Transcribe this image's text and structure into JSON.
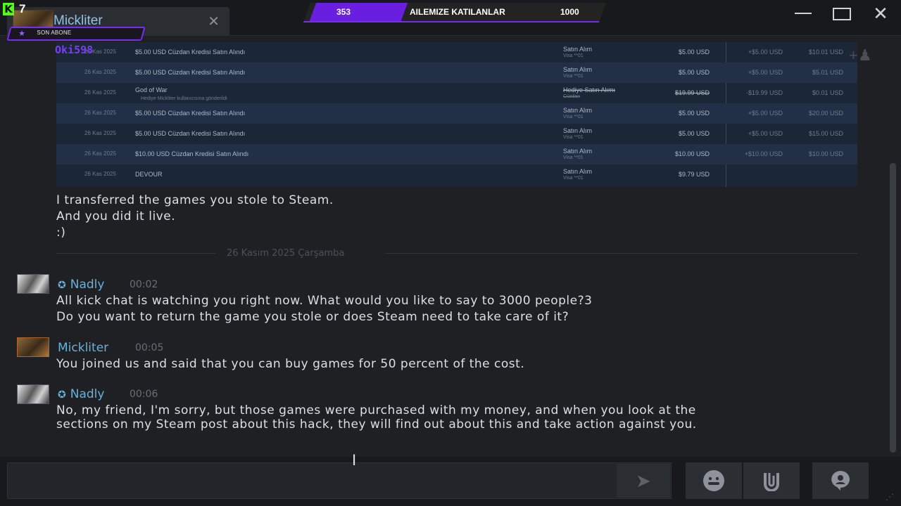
{
  "window": {
    "tab_name": "Mickliter",
    "tab_close": "✕",
    "minimize": "",
    "maximize": "",
    "close": "✕"
  },
  "stream_overlay": {
    "kick_logo": "K",
    "viewer_count": "7",
    "sub_badge": "SON ABONE",
    "followers_current": "353",
    "followers_title": "AILEMIZE KATILANLAR",
    "followers_goal": "1000"
  },
  "embed": {
    "author": "Oki598",
    "rows": [
      {
        "date": "26 Kas 2025",
        "item": "$5.00 USD Cüzdan Kredisi Satın Alındı",
        "item_sub": "",
        "type": "Satın Alım",
        "type_sub": "Visa **01",
        "amount": "$5.00 USD",
        "amount_strike": false,
        "change": "+$5.00 USD",
        "balance": "$10.01 USD"
      },
      {
        "date": "26 Kas 2025",
        "item": "$5.00 USD Cüzdan Kredisi Satın Alındı",
        "item_sub": "",
        "type": "Satın Alım",
        "type_sub": "Visa **01",
        "amount": "$5.00 USD",
        "amount_strike": false,
        "change": "+$5.00 USD",
        "balance": "$5.01 USD"
      },
      {
        "date": "26 Kas 2025",
        "item": "God of War",
        "item_sub": "Hediye Mickliter kullanıcısına gönderildi",
        "type": "Hediye Satın Alımı",
        "type_sub": "Cüzdan",
        "amount": "$19.99 USD",
        "amount_strike": true,
        "change": "-$19.99 USD",
        "balance": "$0.01 USD"
      },
      {
        "date": "26 Kas 2025",
        "item": "$5.00 USD Cüzdan Kredisi Satın Alındı",
        "item_sub": "",
        "type": "Satın Alım",
        "type_sub": "Visa **01",
        "amount": "$5.00 USD",
        "amount_strike": false,
        "change": "+$5.00 USD",
        "balance": "$20.00 USD"
      },
      {
        "date": "26 Kas 2025",
        "item": "$5.00 USD Cüzdan Kredisi Satın Alındı",
        "item_sub": "",
        "type": "Satın Alım",
        "type_sub": "Visa **01",
        "amount": "$5.00 USD",
        "amount_strike": false,
        "change": "+$5.00 USD",
        "balance": "$15.00 USD"
      },
      {
        "date": "26 Kas 2025",
        "item": "$10.00 USD Cüzdan Kredisi Satın Alındı",
        "item_sub": "",
        "type": "Satın Alım",
        "type_sub": "Visa **01",
        "amount": "$10.00 USD",
        "amount_strike": false,
        "change": "+$10.00 USD",
        "balance": "$10.00 USD"
      },
      {
        "date": "26 Kas 2025",
        "item": "DEVOUR",
        "item_sub": "",
        "type": "Satın Alım",
        "type_sub": "Visa **01",
        "amount": "$9.79 USD",
        "amount_strike": false,
        "change": "",
        "balance": ""
      }
    ]
  },
  "messages": {
    "prev_lines": [
      "I transferred the games you stole to Steam.",
      "And you did it live.",
      ":)"
    ],
    "date_divider": "26 Kasım 2025 Çarşamba",
    "m1": {
      "sender": "Nadly",
      "time": "00:02",
      "lines": [
        "All kick chat is watching you right now. What would you like to say to 3000 people?3",
        "Do you want to return the game you stole or does Steam need to take care of it?"
      ]
    },
    "m2": {
      "sender": "Mickliter",
      "time": "00:05",
      "lines": [
        "You joined us and said that you can buy games for 50 percent of the cost."
      ]
    },
    "m3": {
      "sender": "Nadly",
      "time": "00:06",
      "lines": [
        "No, my friend, I'm sorry, but those games were purchased with my money, and when you look at the",
        "sections on my Steam post about this hack, they will find out about this and take action against you."
      ]
    }
  },
  "input": {
    "placeholder": "",
    "value": ""
  },
  "icons": {
    "send": "send-icon",
    "emoji": "emoji-icon",
    "attach": "attach-icon",
    "voice": "voice-icon"
  },
  "colors": {
    "accent_purple": "#7b2cf2",
    "kick_green": "#53fc18",
    "name_blue": "#6ab1d9"
  }
}
